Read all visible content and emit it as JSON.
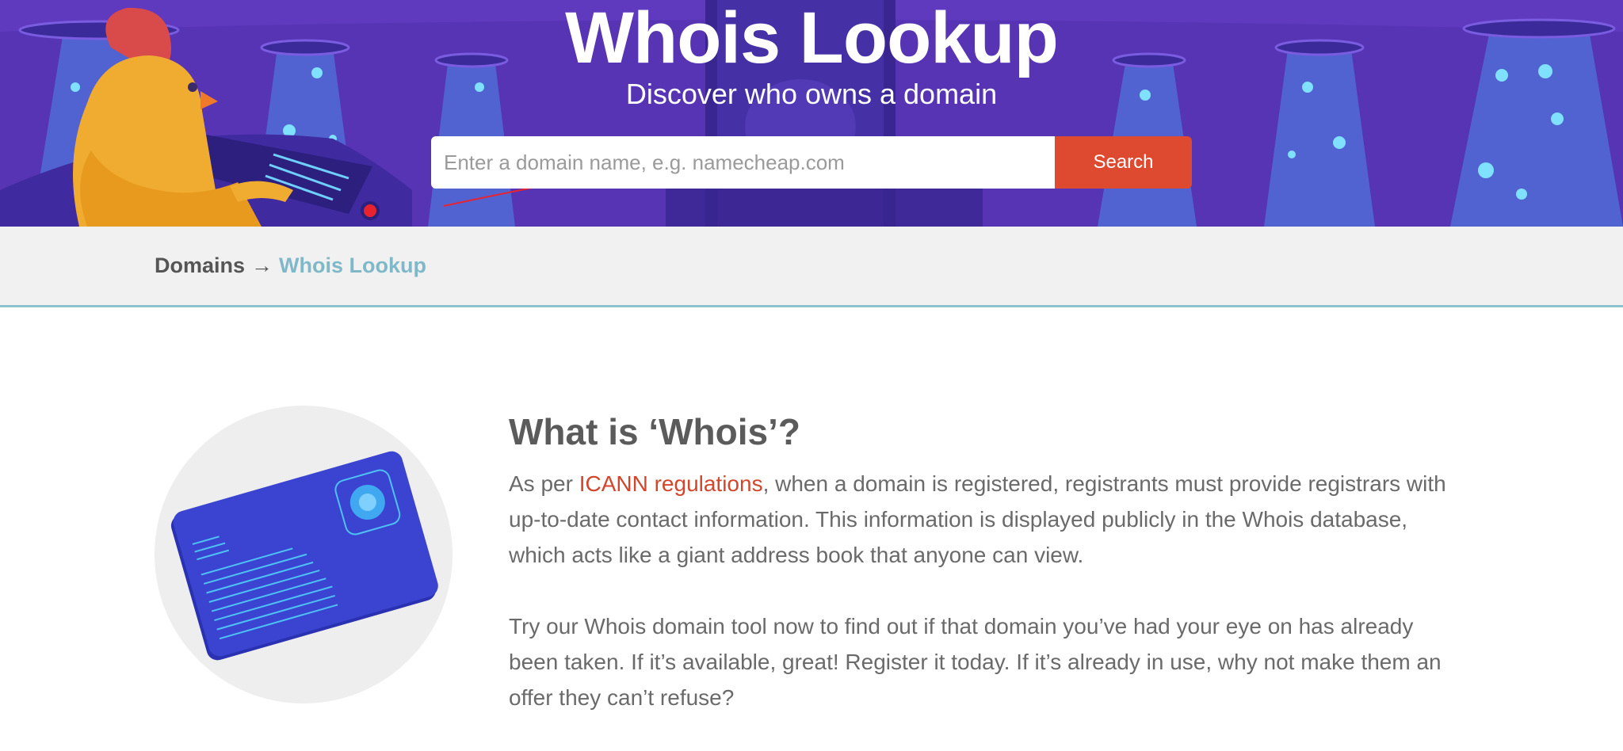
{
  "hero": {
    "title": "Whois Lookup",
    "subtitle": "Discover who owns a domain",
    "search_placeholder": "Enter a domain name, e.g. namecheap.com",
    "search_button": "Search"
  },
  "breadcrumb": {
    "parent": "Domains",
    "separator": "→",
    "current": "Whois Lookup"
  },
  "content": {
    "heading": "What is ‘Whois’?",
    "p1_prefix": "As per ",
    "p1_link": "ICANN regulations",
    "p1_suffix": ", when a domain is registered, registrants must provide registrars with up-to-date contact information. This information is displayed publicly in the Whois database, which acts like a giant address book that anyone can view.",
    "p2": "Try our Whois domain tool now to find out if that domain you’ve had your eye on has already been taken. If it’s available, great! Register it today. If it’s already in use, why not make them an offer they can’t refuse?"
  },
  "colors": {
    "hero_bg": "#4a2ea6",
    "accent": "#de4a30",
    "breadcrumb_current": "#7fb8c8"
  },
  "icons": {
    "hero_illustration": "chicken-at-control-panel-illustration",
    "content_illustration": "id-card-illustration"
  }
}
